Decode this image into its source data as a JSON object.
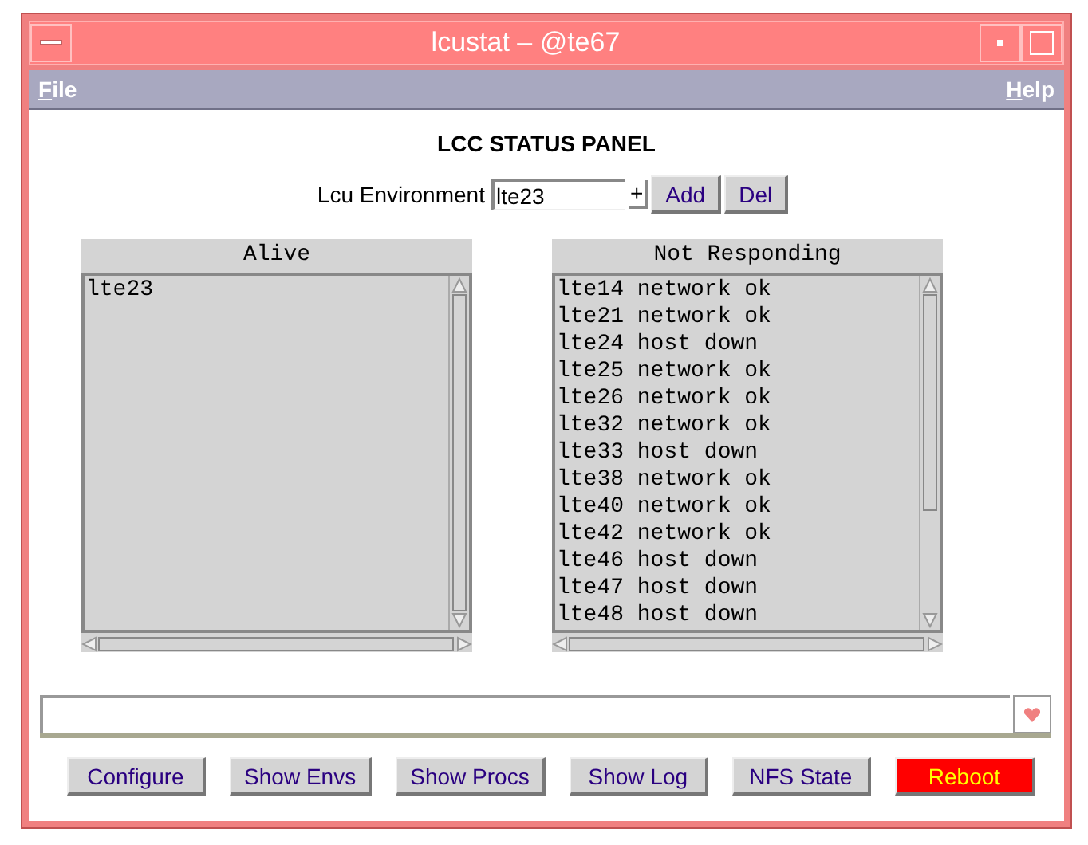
{
  "window": {
    "title": "lcustat – @te67"
  },
  "menu": [
    {
      "label": "File"
    },
    {
      "label": "Help"
    }
  ],
  "panel_title": "LCC STATUS PANEL",
  "environment": {
    "label": "Lcu Environment",
    "value": "lte23",
    "plus": "+",
    "buttons": [
      "Add",
      "Del"
    ]
  },
  "lists": [
    {
      "title": "Alive",
      "items": [
        "lte23"
      ]
    },
    {
      "title": "Not Responding",
      "items": [
        "lte14 network ok",
        "lte21 network ok",
        "lte24 host down",
        "lte25 network ok",
        "lte26 network ok",
        "lte32 network ok",
        "lte33 host down",
        "lte38 network ok",
        "lte40 network ok",
        "lte42 network ok",
        "lte46 host down",
        "lte47 host down",
        "lte48 host down"
      ]
    }
  ],
  "buttons": [
    {
      "label": "Configure",
      "kind": "normal"
    },
    {
      "label": "Show Envs",
      "kind": "normal"
    },
    {
      "label": "Show Procs",
      "kind": "normal"
    },
    {
      "label": "Show Log",
      "kind": "normal"
    },
    {
      "label": "NFS State",
      "kind": "normal"
    },
    {
      "label": "Reboot",
      "kind": "danger"
    }
  ]
}
